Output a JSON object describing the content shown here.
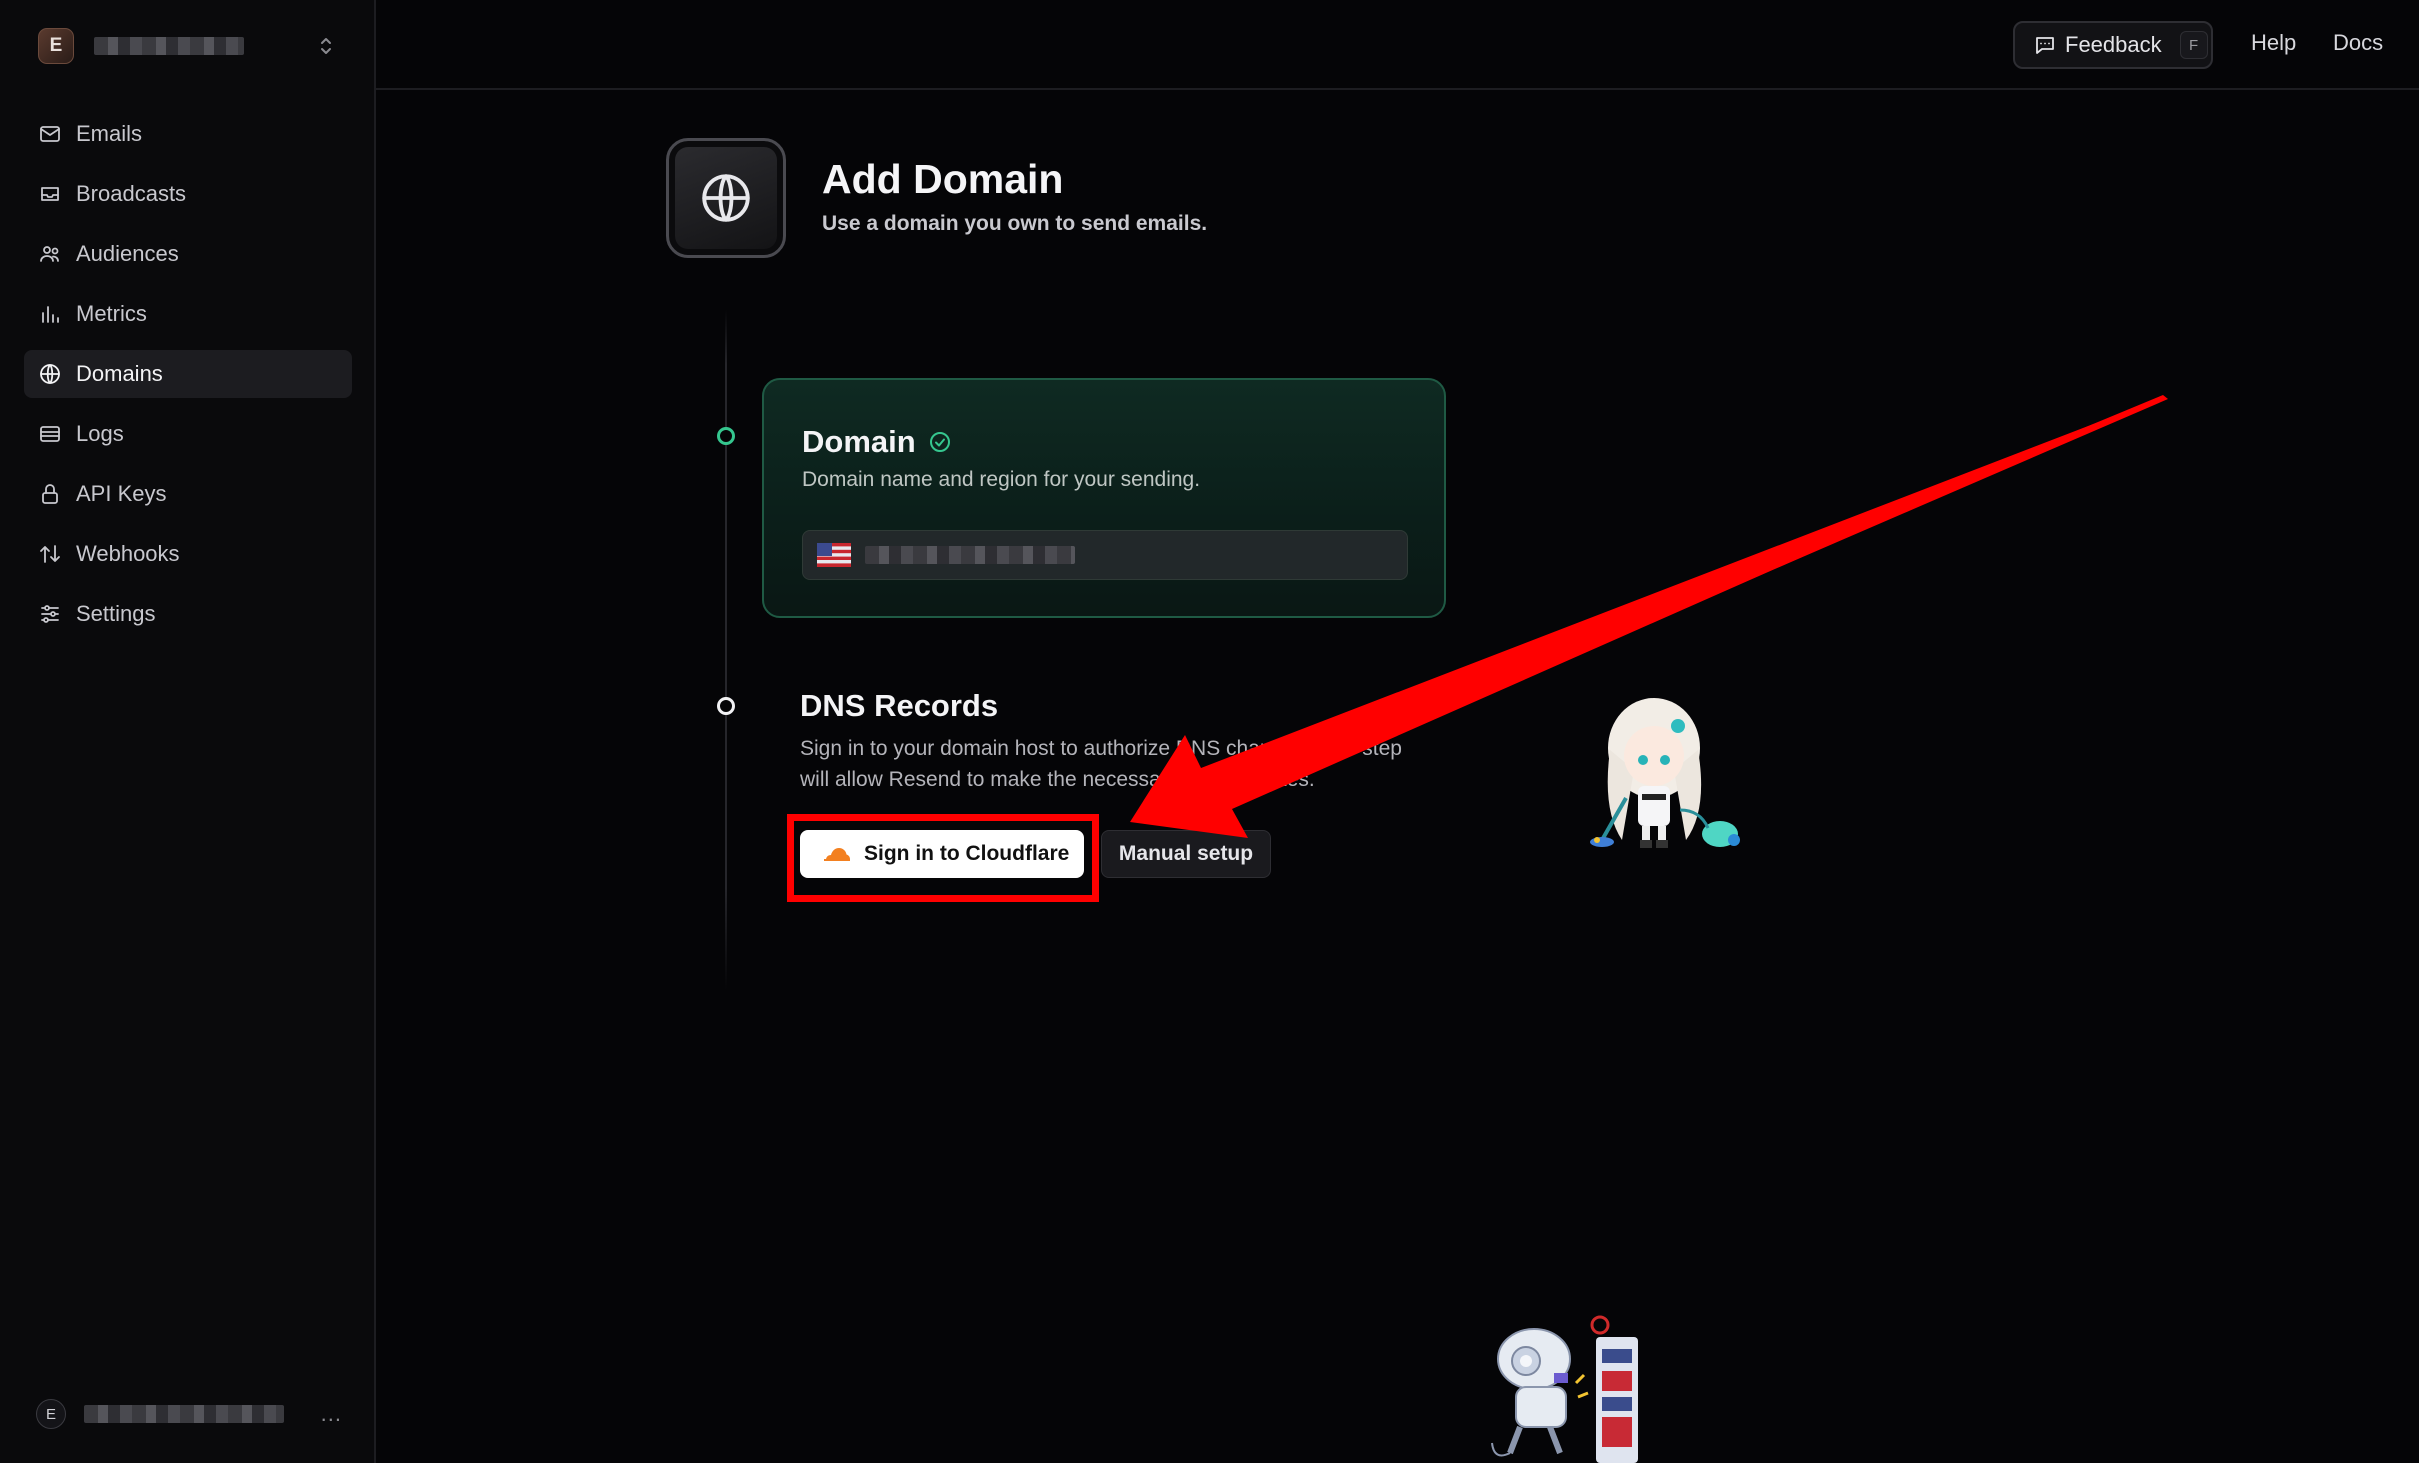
{
  "sidebar": {
    "team": {
      "initial": "E",
      "name": "████████"
    },
    "items": [
      {
        "label": "Emails",
        "icon": "mail-icon"
      },
      {
        "label": "Broadcasts",
        "icon": "inbox-icon"
      },
      {
        "label": "Audiences",
        "icon": "users-icon"
      },
      {
        "label": "Metrics",
        "icon": "bar-chart-icon"
      },
      {
        "label": "Domains",
        "icon": "globe-icon",
        "active": true
      },
      {
        "label": "Logs",
        "icon": "list-icon"
      },
      {
        "label": "API Keys",
        "icon": "lock-icon"
      },
      {
        "label": "Webhooks",
        "icon": "arrows-updown-icon"
      },
      {
        "label": "Settings",
        "icon": "sliders-icon"
      }
    ],
    "user": {
      "initial": "E",
      "name": "████████",
      "more": "..."
    }
  },
  "topbar": {
    "feedback_label": "Feedback",
    "feedback_shortcut": "F",
    "help_label": "Help",
    "docs_label": "Docs"
  },
  "page": {
    "title": "Add Domain",
    "subtitle": "Use a domain you own to send emails."
  },
  "domain_step": {
    "title": "Domain",
    "description": "Domain name and region for your sending.",
    "domain_value": "████████",
    "status": "completed"
  },
  "dns_step": {
    "title": "DNS Records",
    "description": "Sign in to your domain host to authorize DNS changes. This step will allow Resend to make the necessary DNS updates.",
    "primary_button": "Sign in to Cloudflare",
    "secondary_button": "Manual setup"
  },
  "colors": {
    "accent_green": "#35c78f",
    "annotation_red": "#ff0000",
    "cloudflare_orange": "#f38020"
  }
}
